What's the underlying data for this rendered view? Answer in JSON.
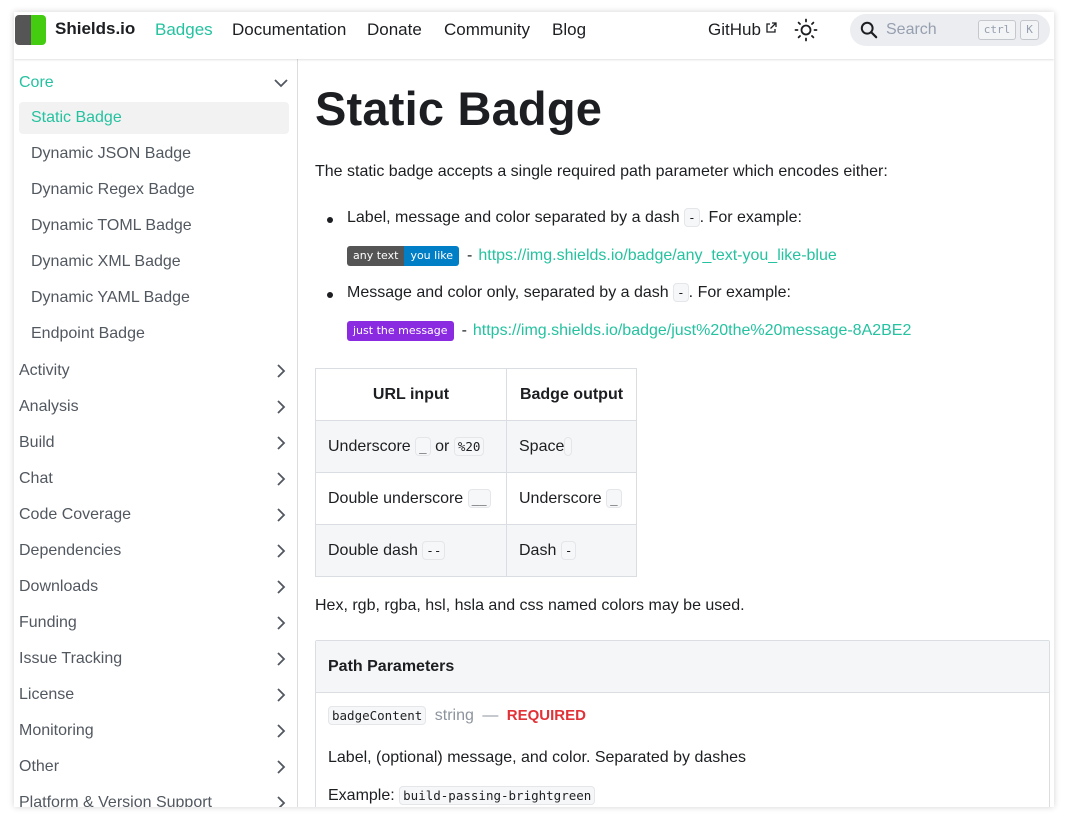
{
  "navbar": {
    "brand": "Shields.io",
    "links": [
      "Badges",
      "Documentation",
      "Donate",
      "Community",
      "Blog"
    ],
    "github": "GitHub",
    "search_placeholder": "Search",
    "kbd_ctrl": "ctrl",
    "kbd_k": "K"
  },
  "sidebar": {
    "core": "Core",
    "core_items": [
      "Static Badge",
      "Dynamic JSON Badge",
      "Dynamic Regex Badge",
      "Dynamic TOML Badge",
      "Dynamic XML Badge",
      "Dynamic YAML Badge",
      "Endpoint Badge"
    ],
    "categories": [
      "Activity",
      "Analysis",
      "Build",
      "Chat",
      "Code Coverage",
      "Dependencies",
      "Downloads",
      "Funding",
      "Issue Tracking",
      "License",
      "Monitoring",
      "Other",
      "Platform & Version Support"
    ]
  },
  "main": {
    "title": "Static Badge",
    "intro": "The static badge accepts a single required path parameter which encodes either:",
    "bullet1_a": "Label, message and color separated by a dash",
    "bullet1_code": "-",
    "bullet1_b": ". For example:",
    "badge1_label": "any text",
    "badge1_message": "you like",
    "badge1_color": "#007ec6",
    "url1": "https://img.shields.io/badge/any_text-you_like-blue",
    "bullet2_a": "Message and color only, separated by a dash",
    "bullet2_code": "-",
    "bullet2_b": ". For example:",
    "badge2_message": "just the message",
    "badge2_color": "#8a2be2",
    "url2": "https://img.shields.io/badge/just%20the%20message-8A2BE2",
    "dash": "-",
    "table": {
      "headers": [
        "URL input",
        "Badge output"
      ],
      "r1": {
        "a": "Underscore",
        "code1": "_",
        "or": "or",
        "code2": "%20",
        "b": "Space",
        "bcode": " "
      },
      "r2": {
        "a": "Double underscore",
        "code1": "__",
        "b": "Underscore",
        "bcode": "_"
      },
      "r3": {
        "a": "Double dash",
        "code1": "--",
        "b": "Dash",
        "bcode": "-"
      }
    },
    "colors_note": "Hex, rgb, rgba, hsl, hsla and css named colors may be used.",
    "params": {
      "heading": "Path Parameters",
      "name": "badgeContent",
      "type": "string",
      "sep": "—",
      "required": "REQUIRED",
      "desc": "Label, (optional) message, and color. Separated by dashes",
      "example_label": "Example:",
      "example_value": "build-passing-brightgreen"
    }
  },
  "colors": {
    "accent": "#25c2a0",
    "badge_label_bg": "#555555",
    "required": "#e13238"
  }
}
